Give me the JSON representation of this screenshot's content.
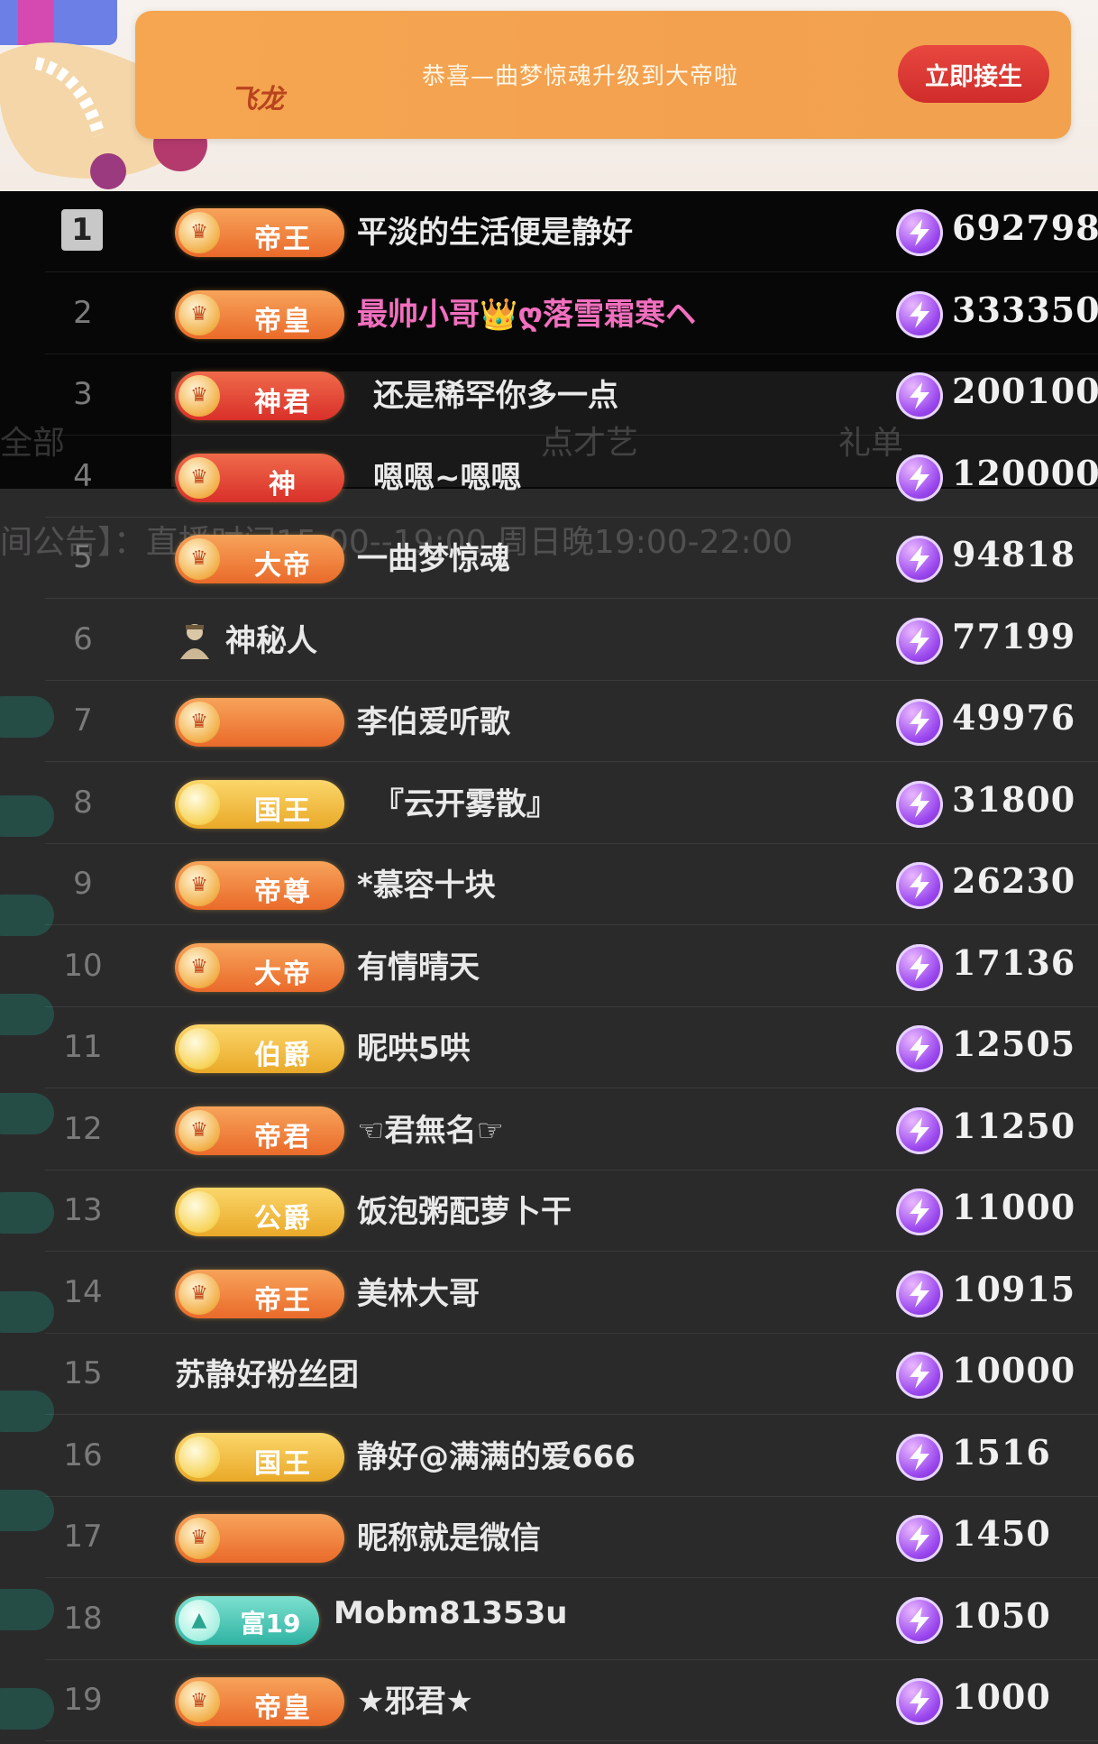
{
  "banner": {
    "message": "恭喜—曲梦惊魂升级到大帝啦",
    "button_label": "立即接生",
    "deco_text": "飞龙"
  },
  "background_ghost": {
    "tab_all": "全部",
    "notice": "间公告】：直播时间15:00--19:00 周日晚19:00-22:00",
    "col2": "点才艺",
    "col3": "礼单"
  },
  "ranking": {
    "rows": [
      {
        "rank": "1",
        "badge": "帝王",
        "badge_style": "orange",
        "name": "平淡的生活便是静好",
        "name_style": "normal",
        "score": "692798"
      },
      {
        "rank": "2",
        "badge": "帝皇",
        "badge_style": "orange",
        "name": "最帅小哥👑ღ落雪霜寒ヘ",
        "name_style": "pink",
        "score": "333350"
      },
      {
        "rank": "3",
        "badge": "神君",
        "badge_style": "red",
        "name": "还是稀罕你多一点",
        "name_style": "normal",
        "score": "200100"
      },
      {
        "rank": "4",
        "badge": "神",
        "badge_style": "red",
        "name": "嗯嗯~嗯嗯",
        "name_style": "normal",
        "score": "120000"
      },
      {
        "rank": "5",
        "badge": "大帝",
        "badge_style": "orange",
        "name": "一曲梦惊魂",
        "name_style": "normal",
        "score": "94818"
      },
      {
        "rank": "6",
        "badge": "",
        "badge_style": "none",
        "name": "神秘人",
        "name_style": "normal",
        "score": "77199"
      },
      {
        "rank": "7",
        "badge": "",
        "badge_style": "orange",
        "name": "李伯爱听歌",
        "name_style": "normal",
        "score": "49976"
      },
      {
        "rank": "8",
        "badge": "国王",
        "badge_style": "gold",
        "name": "『云开雾散』",
        "name_style": "normal",
        "score": "31800"
      },
      {
        "rank": "9",
        "badge": "帝尊",
        "badge_style": "orange",
        "name": "*慕容十块",
        "name_style": "normal",
        "score": "26230"
      },
      {
        "rank": "10",
        "badge": "大帝",
        "badge_style": "orange",
        "name": "有情晴天",
        "name_style": "normal",
        "score": "17136"
      },
      {
        "rank": "11",
        "badge": "伯爵",
        "badge_style": "gold",
        "name": "昵哄5哄",
        "name_style": "normal",
        "score": "12505"
      },
      {
        "rank": "12",
        "badge": "帝君",
        "badge_style": "orange",
        "name": "☜君無名☞",
        "name_style": "normal",
        "score": "11250"
      },
      {
        "rank": "13",
        "badge": "公爵",
        "badge_style": "gold",
        "name": "饭泡粥配萝卜干",
        "name_style": "normal",
        "score": "11000"
      },
      {
        "rank": "14",
        "badge": "帝王",
        "badge_style": "orange",
        "name": "美林大哥",
        "name_style": "normal",
        "score": "10915"
      },
      {
        "rank": "15",
        "badge": "",
        "badge_style": "none",
        "name": "苏静好粉丝团",
        "name_style": "normal",
        "score": "10000"
      },
      {
        "rank": "16",
        "badge": "国王",
        "badge_style": "gold",
        "name": "静好@满满的爱666",
        "name_style": "normal",
        "score": "1516"
      },
      {
        "rank": "17",
        "badge": "",
        "badge_style": "orange",
        "name": "昵称就是微信",
        "name_style": "normal",
        "score": "1450"
      },
      {
        "rank": "18",
        "badge": "富19",
        "badge_style": "teal",
        "name": "Mobm81353u",
        "name_style": "normal",
        "score": "1050"
      },
      {
        "rank": "19",
        "badge": "帝皇",
        "badge_style": "orange",
        "name": "★邪君★",
        "name_style": "normal",
        "score": "1000"
      }
    ]
  },
  "colors": {
    "banner": "#f3a14f",
    "button": "#d9302a",
    "panel": "#2b2a2b",
    "coin": "#9b48ee",
    "vip_name": "#f16fbe"
  },
  "icons": {
    "coin": "lightning-coin-icon",
    "emblem": "rank-emblem-icon",
    "avatar": "mystery-avatar-icon"
  }
}
